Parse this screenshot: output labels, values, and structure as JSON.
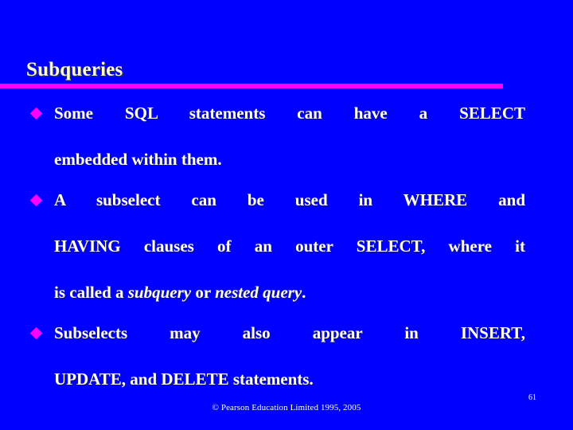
{
  "slide": {
    "background_color": "#0000ff",
    "title": "Subqueries",
    "title_color": "#ffffcc",
    "rule_color": "#ff00ff",
    "bullet_marker_color": "#ff00ff",
    "body_text_color": "#ffffff",
    "bullets": [
      {
        "marker": "diamond-bullet",
        "line1": "Some SQL statements can have a SELECT",
        "line2": "embedded within them.",
        "plain": "Some SQL statements can have a SELECT embedded within them."
      },
      {
        "marker": "diamond-bullet",
        "line1": "A subselect can be used in WHERE and",
        "line2": "HAVING clauses of an outer SELECT, where it",
        "line3_a": "is called a ",
        "line3_italic_1": "subquery",
        "line3_b": " or ",
        "line3_italic_2": "nested query",
        "line3_c": ".",
        "plain": "A subselect can be used in WHERE and HAVING clauses of an outer SELECT, where it is called a subquery or nested query."
      },
      {
        "marker": "diamond-bullet",
        "line1": "Subselects may also appear in INSERT,",
        "line2": "UPDATE, and DELETE statements.",
        "plain": "Subselects may also appear in INSERT, UPDATE, and DELETE statements."
      }
    ],
    "footer": {
      "copyright": "© Pearson Education Limited 1995, 2005",
      "page_number": "61"
    }
  }
}
